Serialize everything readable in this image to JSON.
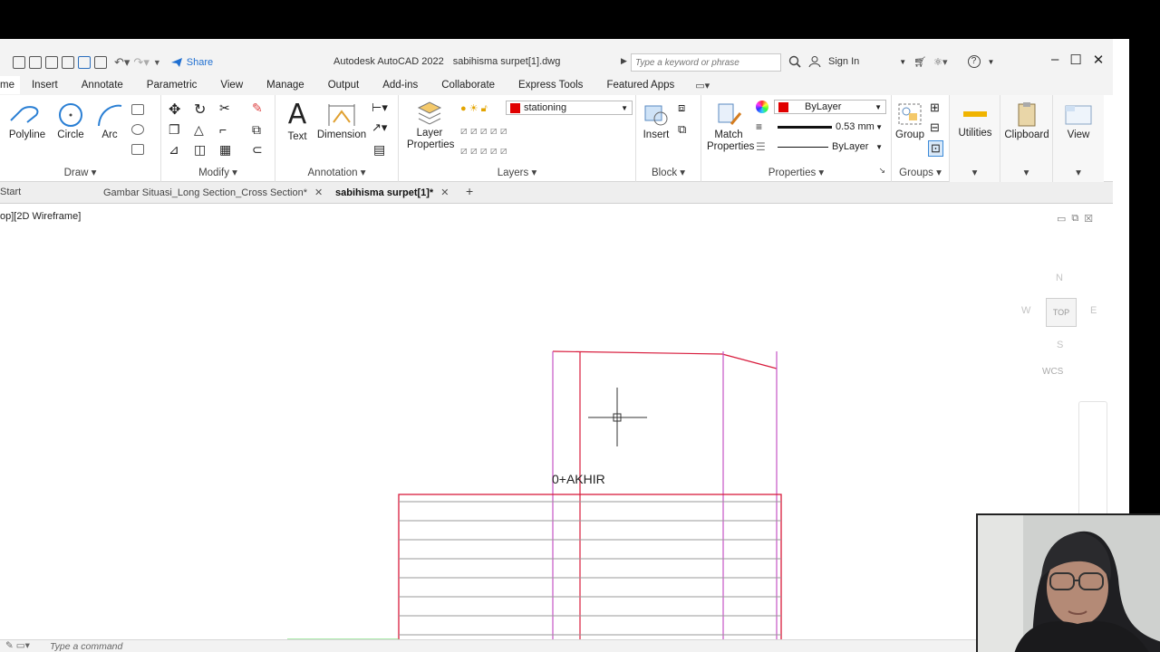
{
  "window": {
    "app_title": "Autodesk AutoCAD 2022",
    "file_title": "sabihisma surpet[1].dwg",
    "search_placeholder": "Type a keyword or phrase",
    "sign_in": "Sign In",
    "share": "Share"
  },
  "ribbon_tabs": [
    "me",
    "Insert",
    "Annotate",
    "Parametric",
    "View",
    "Manage",
    "Output",
    "Add-ins",
    "Collaborate",
    "Express Tools",
    "Featured Apps"
  ],
  "ribbon": {
    "draw": {
      "title": "Draw",
      "polyline": "Polyline",
      "circle": "Circle",
      "arc": "Arc"
    },
    "modify": {
      "title": "Modify"
    },
    "annotation": {
      "title": "Annotation",
      "text": "Text",
      "dimension": "Dimension"
    },
    "layers": {
      "title": "Layers",
      "layer_properties": "Layer Properties",
      "current_layer": "stationing"
    },
    "block": {
      "title": "Block",
      "insert": "Insert"
    },
    "properties": {
      "title": "Properties",
      "match_properties": "Match Properties",
      "color": "ByLayer",
      "lineweight": "0.53 mm",
      "linetype": "ByLayer"
    },
    "groups": {
      "title": "Groups",
      "group": "Group"
    },
    "utilities": "Utilities",
    "clipboard": "Clipboard",
    "view": "View"
  },
  "doc_tabs": [
    "Start",
    "Gambar Situasi_Long Section_Cross Section*",
    "sabihisma surpet[1]*"
  ],
  "viewport": {
    "label": "op][2D Wireframe]",
    "viewcube_top": "TOP",
    "compass": {
      "n": "N",
      "s": "S",
      "e": "E",
      "w": "W"
    },
    "wcs": "WCS",
    "drawing_label": "0+AKHIR"
  },
  "command_line": {
    "placeholder": "Type a command"
  },
  "colors": {
    "accent": "#1f6fd1",
    "layer_red": "#e00000",
    "drawing_red": "#d81b3c",
    "drawing_magenta": "#c653c6",
    "drawing_green": "#58d858"
  }
}
